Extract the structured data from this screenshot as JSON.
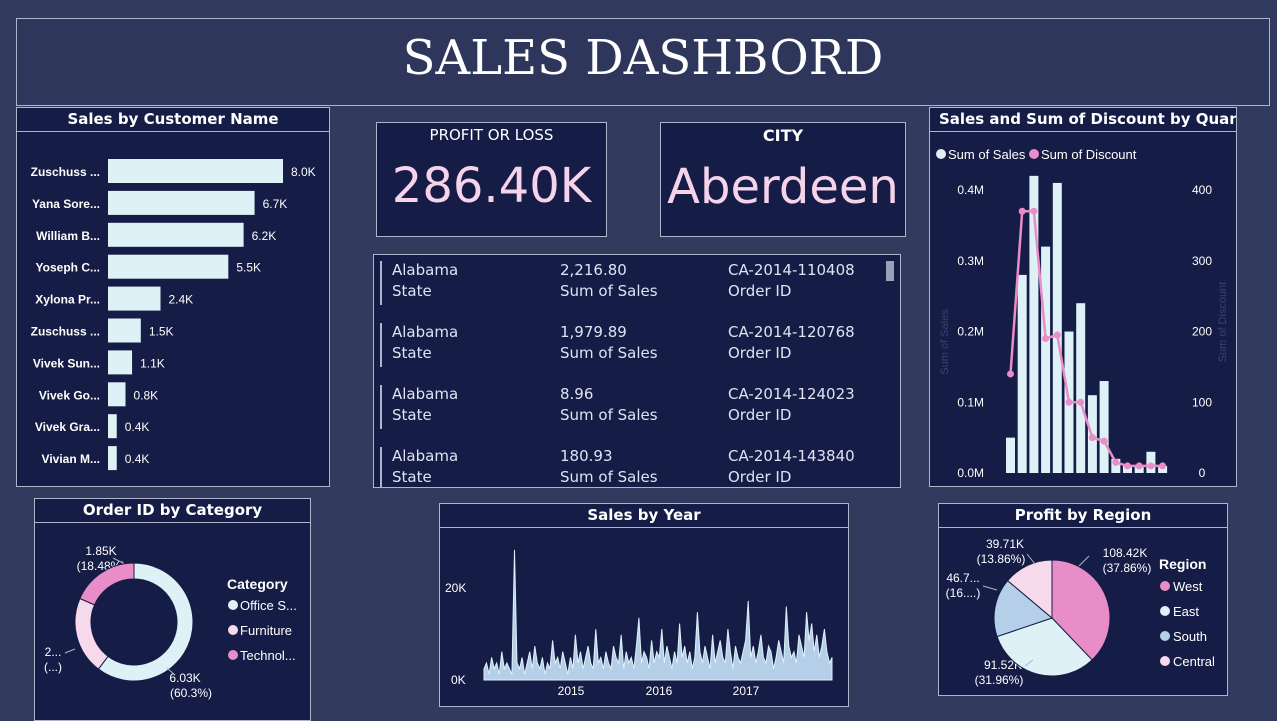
{
  "header": {
    "title": "SALES DASHBORD"
  },
  "customer_chart": {
    "title": "Sales by Customer Name",
    "rows": [
      {
        "name": "Zuschuss ...",
        "value": 8.0,
        "label": "8.0K"
      },
      {
        "name": "Yana Sore...",
        "value": 6.7,
        "label": "6.7K"
      },
      {
        "name": "William B...",
        "value": 6.2,
        "label": "6.2K"
      },
      {
        "name": "Yoseph C...",
        "value": 5.5,
        "label": "5.5K"
      },
      {
        "name": "Xylona Pr...",
        "value": 2.4,
        "label": "2.4K"
      },
      {
        "name": "Zuschuss ...",
        "value": 1.5,
        "label": "1.5K"
      },
      {
        "name": "Vivek Sun...",
        "value": 1.1,
        "label": "1.1K"
      },
      {
        "name": "Vivek Go...",
        "value": 0.8,
        "label": "0.8K"
      },
      {
        "name": "Vivek Gra...",
        "value": 0.4,
        "label": "0.4K"
      },
      {
        "name": "Vivian M...",
        "value": 0.4,
        "label": "0.4K"
      }
    ]
  },
  "kpi_profit": {
    "title": "PROFIT OR LOSS",
    "value": "286.40K"
  },
  "kpi_city": {
    "title": "CITY",
    "value": "Aberdeen"
  },
  "multirow": {
    "rows": [
      {
        "state": "Alabama",
        "sales": "2,216.80",
        "order": "CA-2014-110408"
      },
      {
        "state": "Alabama",
        "sales": "1,979.89",
        "order": "CA-2014-120768"
      },
      {
        "state": "Alabama",
        "sales": "8.96",
        "order": "CA-2014-124023"
      },
      {
        "state": "Alabama",
        "sales": "180.93",
        "order": "CA-2014-143840"
      }
    ],
    "state_caption": "State",
    "sales_caption": "Sum of Sales",
    "order_caption": "Order ID"
  },
  "combo_chart": {
    "title": "Sales and Sum of Discount by Quantity",
    "legend": [
      "Sum of Sales",
      "Sum of Discount"
    ],
    "left_axis_title": "Sum of Sales",
    "right_axis_title": "Sum of Discount",
    "left_ticks": [
      "0.4M",
      "0.3M",
      "0.2M",
      "0.1M",
      "0.0M"
    ],
    "right_ticks": [
      "400",
      "300",
      "200",
      "100",
      "0"
    ]
  },
  "donut": {
    "title": "Order ID by Category",
    "legend_title": "Category",
    "legend": [
      "Office S...",
      "Furniture",
      "Technol..."
    ],
    "labels": {
      "tech_value": "1.85K",
      "tech_pct": "(18.48%)",
      "furn_value": "2...",
      "furn_pct": "(...)",
      "office_value": "6.03K",
      "office_pct": "(60.3%)"
    }
  },
  "year_chart": {
    "title": "Sales by Year",
    "y_ticks": [
      "20K",
      "0K"
    ],
    "x_ticks": [
      "2015",
      "2016",
      "2017"
    ]
  },
  "pie": {
    "title": "Profit by Region",
    "legend_title": "Region",
    "legend": [
      "West",
      "East",
      "South",
      "Central"
    ],
    "labels": {
      "west_value": "108.42K",
      "west_pct": "(37.86%)",
      "east_value": "91.52K",
      "east_pct": "(31.96%)",
      "south_value": "46.7...",
      "south_pct": "(16....)",
      "central_value": "39.71K",
      "central_pct": "(13.86%)"
    }
  },
  "colors": {
    "background": "#323a5e",
    "panel": "#151c45",
    "bar_light": "#ddf1f7",
    "pink": "#e98dc8",
    "light_pink": "#f6d9ea",
    "south_blue": "#b6cfe9",
    "kpi_text": "#f6d3ea"
  },
  "chart_data": [
    {
      "type": "bar",
      "title": "Sales by Customer Name",
      "categories": [
        "Zuschuss ...",
        "Yana Sore...",
        "William B...",
        "Yoseph C...",
        "Xylona Pr...",
        "Zuschuss ...",
        "Vivek Sun...",
        "Vivek Go...",
        "Vivek Gra...",
        "Vivian M..."
      ],
      "values": [
        8.0,
        6.7,
        6.2,
        5.5,
        2.4,
        1.5,
        1.1,
        0.8,
        0.4,
        0.4
      ],
      "unit": "K"
    },
    {
      "type": "bar",
      "title": "Sales and Sum of Discount by Quantity",
      "x": [
        1,
        2,
        3,
        4,
        5,
        6,
        7,
        8,
        9,
        10,
        11,
        12,
        13,
        14
      ],
      "series": [
        {
          "name": "Sum of Sales",
          "values": [
            0.05,
            0.28,
            0.42,
            0.32,
            0.41,
            0.2,
            0.24,
            0.11,
            0.13,
            0.02,
            0.01,
            0.01,
            0.03,
            0.01
          ]
        },
        {
          "name": "Sum of Discount",
          "values": [
            140,
            370,
            370,
            190,
            195,
            100,
            100,
            50,
            45,
            15,
            10,
            10,
            10,
            10
          ]
        }
      ],
      "ylim_left": [
        0,
        0.4
      ],
      "ylim_right": [
        0,
        400
      ]
    },
    {
      "type": "pie",
      "title": "Order ID by Category",
      "categories": [
        "Office S...",
        "Furniture",
        "Technol..."
      ],
      "values": [
        60.3,
        21.22,
        18.48
      ]
    },
    {
      "type": "area",
      "title": "Sales by Year",
      "x_ticks": [
        "2015",
        "2016",
        "2017"
      ],
      "ylim": [
        0,
        23
      ],
      "values": [
        2,
        3,
        1,
        4,
        2,
        3,
        1,
        5,
        2,
        3,
        2,
        1,
        23,
        3,
        2,
        4,
        1,
        3,
        5,
        2,
        6,
        3,
        2,
        4,
        1,
        3,
        2,
        7,
        3,
        4,
        2,
        5,
        3,
        1,
        4,
        2,
        8,
        3,
        5,
        2,
        4,
        6,
        3,
        2,
        9,
        3,
        4,
        2,
        5,
        3,
        2,
        6,
        4,
        3,
        8,
        2,
        5,
        3,
        4,
        2,
        6,
        11,
        3,
        5,
        4,
        2,
        7,
        3,
        5,
        4,
        9,
        3,
        6,
        4,
        2,
        5,
        3,
        10,
        4,
        6,
        3,
        5,
        2,
        4,
        12,
        5,
        3,
        6,
        4,
        2,
        8,
        3,
        5,
        7,
        4,
        3,
        9,
        5,
        2,
        6,
        4,
        3,
        5,
        7,
        14,
        4,
        6,
        3,
        5,
        8,
        4,
        3,
        6,
        5,
        2,
        4,
        7,
        5,
        3,
        13,
        6,
        4,
        5,
        3,
        8,
        6,
        4,
        12,
        7,
        10,
        5,
        8,
        4,
        6,
        9,
        5,
        3,
        4
      ]
    },
    {
      "type": "pie",
      "title": "Profit by Region",
      "categories": [
        "West",
        "East",
        "South",
        "Central"
      ],
      "values": [
        37.86,
        31.96,
        16.32,
        13.86
      ]
    }
  ]
}
